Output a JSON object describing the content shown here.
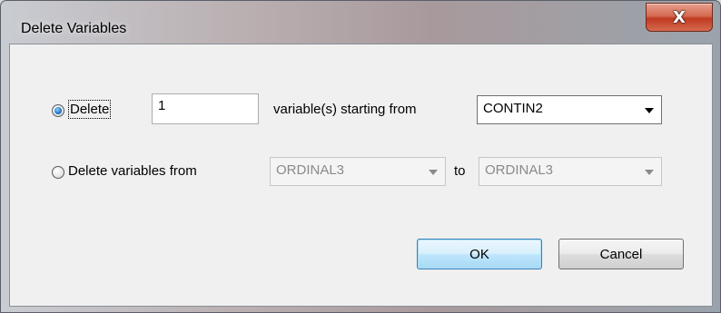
{
  "window": {
    "title": "Delete Variables",
    "close_glyph": "X"
  },
  "row1": {
    "radio_checked": true,
    "radio_label": "Delete",
    "count_value": "1",
    "mid_label": "variable(s) starting from",
    "start_var": {
      "selected": "CONTIN2",
      "enabled": true
    }
  },
  "row2": {
    "radio_checked": false,
    "radio_label": "Delete variables from",
    "from_var": {
      "selected": "ORDINAL3",
      "enabled": false
    },
    "to_label": "to",
    "to_var": {
      "selected": "ORDINAL3",
      "enabled": false
    }
  },
  "buttons": {
    "ok_label": "OK",
    "cancel_label": "Cancel"
  },
  "colors": {
    "default_button": "#bee6fd",
    "radio_dot": "#1e73c8",
    "close_button": "#c03a22"
  }
}
